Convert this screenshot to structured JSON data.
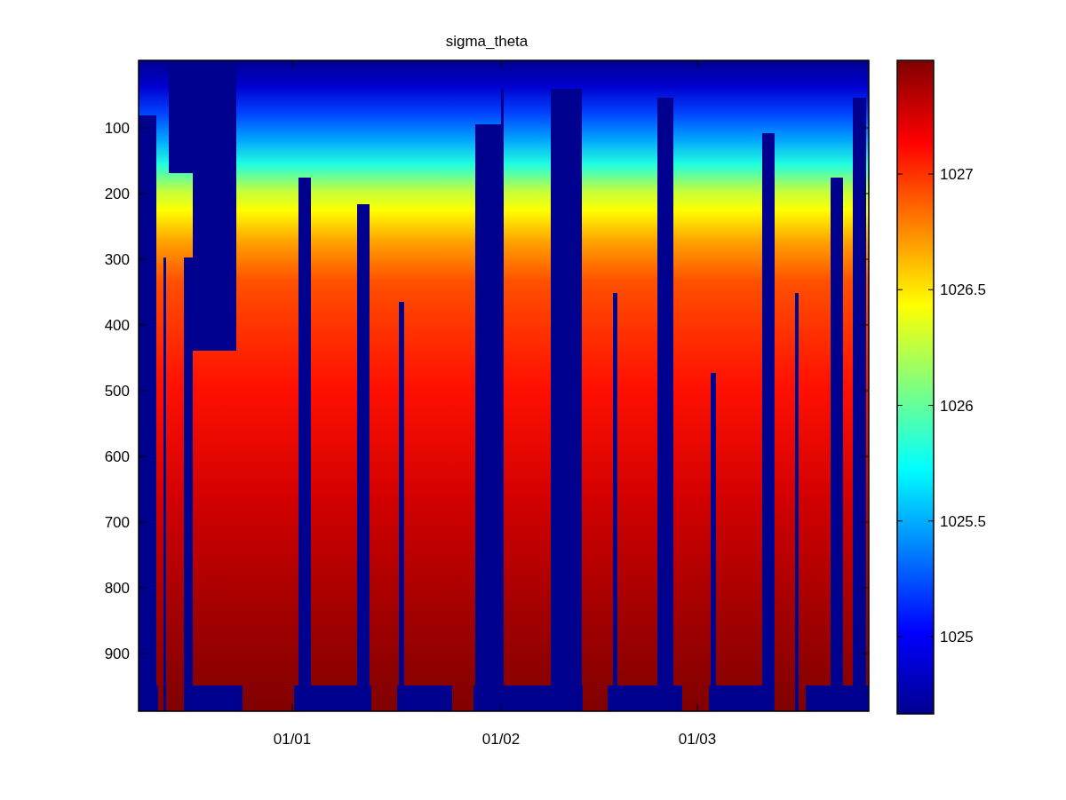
{
  "title": "sigma_theta",
  "y_axis": {
    "ticks": [
      "100",
      "200",
      "300",
      "400",
      "500",
      "600",
      "700",
      "800",
      "900"
    ]
  },
  "x_axis": {
    "ticks": [
      "01/01",
      "01/02",
      "01/03"
    ]
  },
  "colorbar": {
    "ticks": [
      "1027",
      "1026.5",
      "1026",
      "1025.5",
      "1025"
    ]
  }
}
